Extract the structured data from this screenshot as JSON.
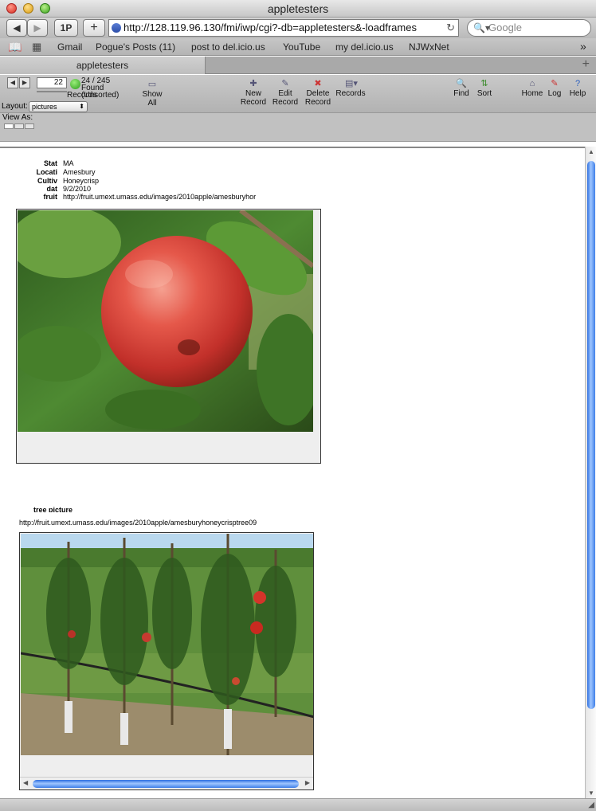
{
  "window": {
    "title": "appletesters"
  },
  "toolbar": {
    "back_label": "◀",
    "forward_label": "▶",
    "onepassword_label": "1P",
    "add_label": "+",
    "url": "http://128.119.96.130/fmi/iwp/cgi?-db=appletesters&-loadframes",
    "search_placeholder": "Google"
  },
  "bookmarks": [
    {
      "label": "Gmail"
    },
    {
      "label": "Pogue's Posts (11)"
    },
    {
      "label": "post to del.icio.us"
    },
    {
      "label": "YouTube"
    },
    {
      "label": "my del.icio.us"
    },
    {
      "label": "NJWxNet"
    }
  ],
  "tabs": [
    {
      "label": "appletesters"
    }
  ],
  "iwp": {
    "record_number": "22",
    "found_count": "24 / 245",
    "found_label": "Found",
    "records_label": "Records",
    "sort_status": "(Unsorted)",
    "show_all": [
      "Show",
      "All"
    ],
    "new_record": [
      "New",
      "Record"
    ],
    "edit_record": [
      "Edit",
      "Record"
    ],
    "delete_record": [
      "Delete",
      "Record"
    ],
    "records_menu": "Records",
    "find": "Find",
    "sort": "Sort",
    "home": "Home",
    "log": "Log",
    "help": "Help",
    "layout_label": "Layout:",
    "layout_value": "pictures",
    "view_as_label": "View As:"
  },
  "record": {
    "fields": [
      {
        "label": "Stat",
        "value": "MA"
      },
      {
        "label": "Locati",
        "value": "Amesbury"
      },
      {
        "label": "Cultiv",
        "value": "Honeycrisp"
      },
      {
        "label": "dat",
        "value": "9/2/2010"
      },
      {
        "label": "fruit",
        "value": "http://fruit.umext.umass.edu/images/2010apple/amesburyhor"
      }
    ],
    "tree_label": "tree picture",
    "tree_url": "http://fruit.umext.umass.edu/images/2010apple/amesburyhoneycrisptree09"
  }
}
